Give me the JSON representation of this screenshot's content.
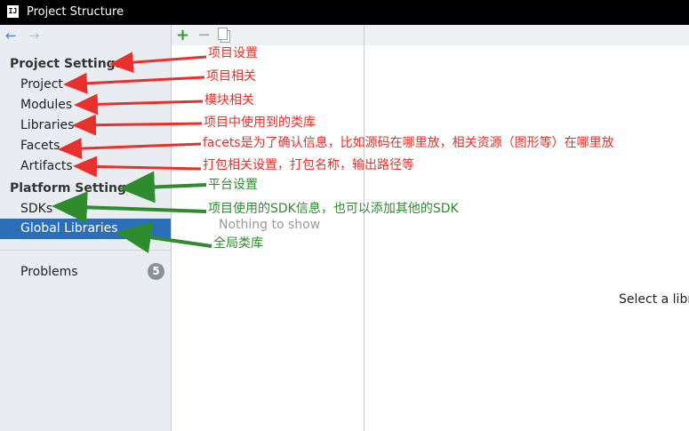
{
  "window": {
    "title": "Project Structure",
    "app_icon_label": "IJ"
  },
  "sidebar": {
    "nav_back_icon": "arrow-left",
    "nav_forward_icon": "arrow-right",
    "project_settings_header": "Project Settings",
    "project_items": [
      "Project",
      "Modules",
      "Libraries",
      "Facets",
      "Artifacts"
    ],
    "platform_settings_header": "Platform Settings",
    "platform_items": [
      "SDKs",
      "Global Libraries"
    ],
    "selected_item": "Global Libraries",
    "problems_label": "Problems",
    "problems_count": "5",
    "selected_color": "#2c6fb8"
  },
  "middle_panel": {
    "add_icon": "plus",
    "remove_icon": "minus",
    "copy_icon": "copy",
    "empty_text": "Nothing to show"
  },
  "right_panel": {
    "hint_text": "Select a libra"
  },
  "annotations": {
    "red_color": "#e8302c",
    "green_color": "#2e8b2e",
    "project_settings": "项目设置",
    "project": "项目相关",
    "modules": "模块相关",
    "libraries": "项目中使用到的类库",
    "facets": "facets是为了确认信息，比如源码在哪里放，相关资源（图形等）在哪里放",
    "artifacts": "打包相关设置，打包名称，输出路径等",
    "platform_settings": "平台设置",
    "sdks": "项目使用的SDK信息，也可以添加其他的SDK",
    "global_libraries": "全局类库"
  }
}
